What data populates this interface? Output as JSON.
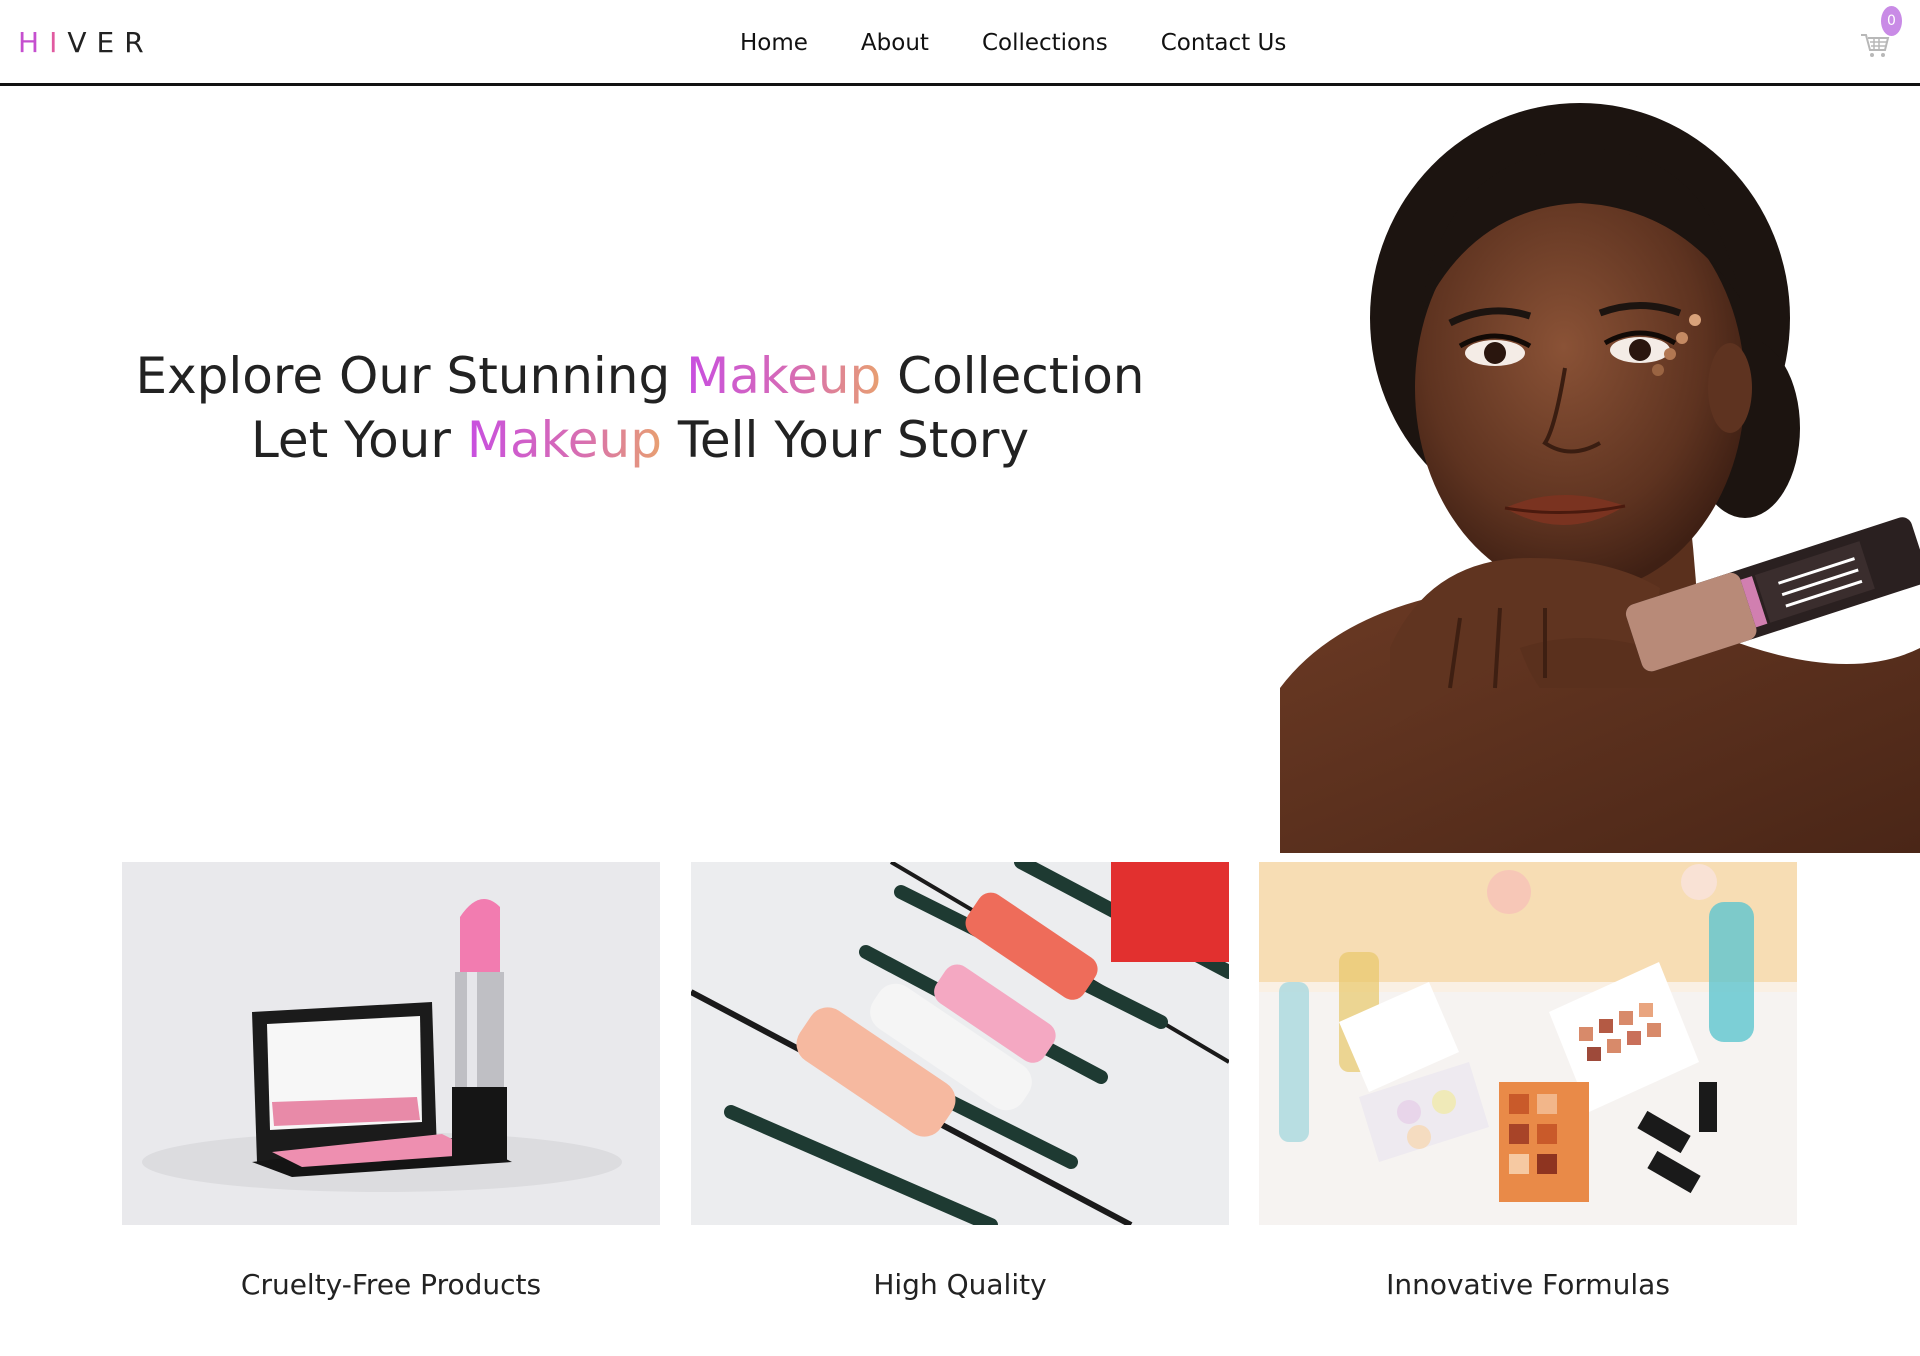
{
  "brand": {
    "letters": [
      "H",
      "I",
      "V",
      "E",
      "R"
    ],
    "letter_colors": [
      "#c54fcf",
      "#e05aa0",
      "#222222",
      "#222222",
      "#222222"
    ]
  },
  "nav": {
    "links": [
      {
        "label": "Home"
      },
      {
        "label": "About"
      },
      {
        "label": "Collections"
      },
      {
        "label": "Contact Us"
      }
    ]
  },
  "cart": {
    "icon": "cart-icon",
    "count": "0",
    "badge_color": "#c98be6"
  },
  "hero": {
    "line1_before": "Explore Our Stunning ",
    "line1_highlight": "Makeup",
    "line1_after": " Collection",
    "line2_before": "Let Your ",
    "line2_highlight": "Makeup",
    "line2_after": " Tell Your Story",
    "highlight_gradient": [
      "#c84fe0",
      "#e8a070"
    ]
  },
  "features": [
    {
      "title": "Cruelty-Free Products",
      "image": "lipstick-blush-compact"
    },
    {
      "title": "High Quality",
      "image": "brushes-and-tubes"
    },
    {
      "title": "Innovative Formulas",
      "image": "eyeshadow-palettes"
    }
  ]
}
